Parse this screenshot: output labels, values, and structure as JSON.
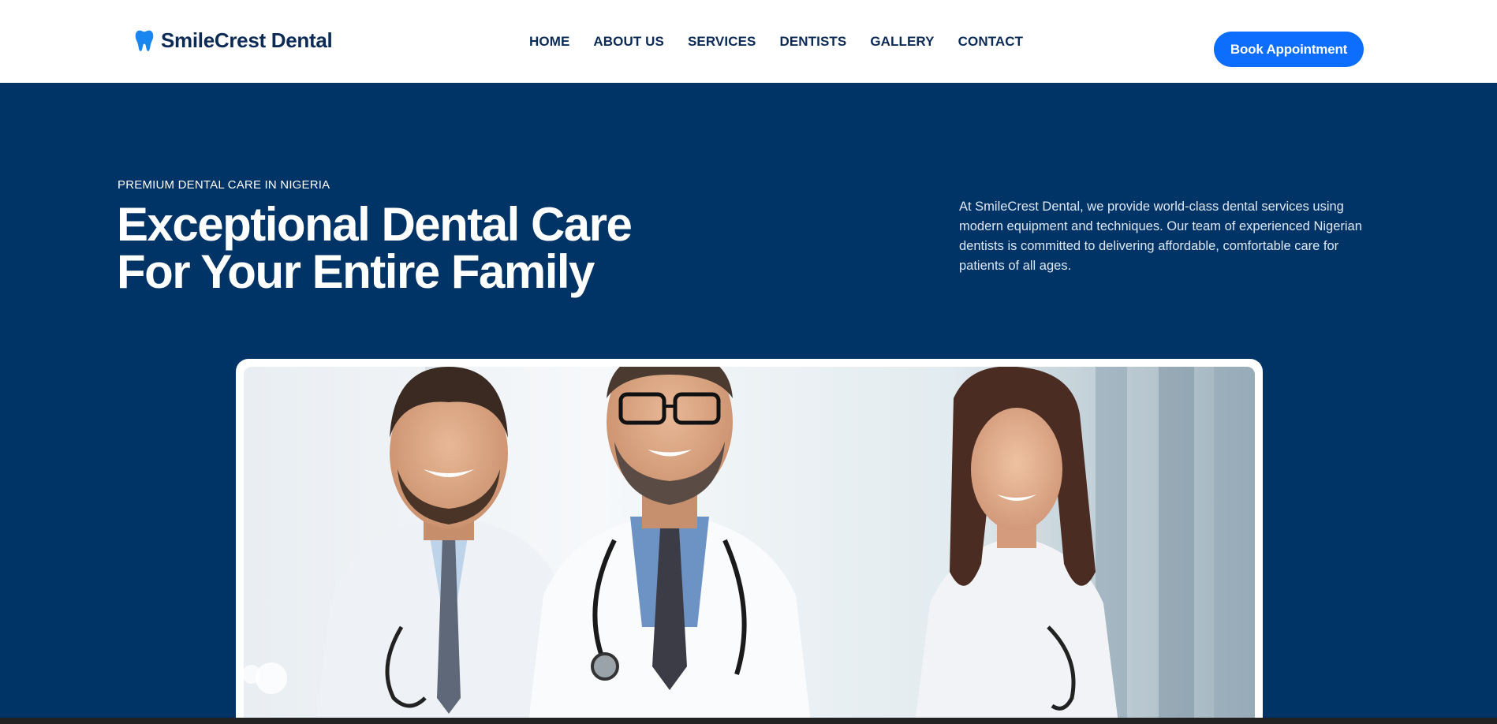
{
  "brand": {
    "name": "SmileCrest Dental",
    "icon": "tooth-icon",
    "accent_color": "#0d6efd",
    "primary_color": "#003366"
  },
  "nav": {
    "items": [
      {
        "label": "HOME"
      },
      {
        "label": "ABOUT US"
      },
      {
        "label": "SERVICES"
      },
      {
        "label": "DENTISTS"
      },
      {
        "label": "GALLERY"
      },
      {
        "label": "CONTACT"
      }
    ],
    "cta_label": "Book Appointment"
  },
  "hero": {
    "eyebrow": "PREMIUM DENTAL CARE IN NIGERIA",
    "headline_line1": "Exceptional Dental Care",
    "headline_line2": "For Your Entire Family",
    "description": "At SmileCrest Dental, we provide world-class dental services using modern equipment and techniques. Our team of experienced Nigerian dentists is committed to delivering affordable, comfortable care for patients of all ages."
  }
}
